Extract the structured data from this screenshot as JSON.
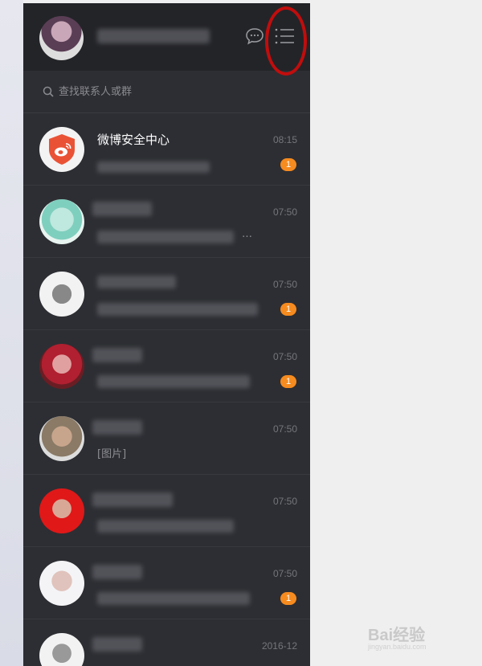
{
  "search": {
    "placeholder": "查找联系人或群"
  },
  "conversations": [
    {
      "name": "微博安全中心",
      "time": "08:15",
      "preview": "",
      "badge": "1"
    },
    {
      "name": "",
      "time": "07:50",
      "preview": "…",
      "badge": ""
    },
    {
      "name": "",
      "time": "07:50",
      "preview": "",
      "badge": "1"
    },
    {
      "name": "",
      "time": "07:50",
      "preview": "",
      "badge": "1"
    },
    {
      "name": "",
      "time": "07:50",
      "preview": "[图片]",
      "badge": ""
    },
    {
      "name": "",
      "time": "07:50",
      "preview": "",
      "badge": ""
    },
    {
      "name": "",
      "time": "07:50",
      "preview": "",
      "badge": "1"
    },
    {
      "name": "",
      "time": "2016-12",
      "preview": "",
      "badge": ""
    }
  ],
  "watermark": {
    "brand": "Bai经验",
    "sub": "jingyan.baidu.com"
  },
  "icons": {
    "chat": "chat-bubble-icon",
    "menu": "list-menu-icon",
    "search": "search-icon",
    "weibo": "weibo-shield-icon"
  },
  "colors": {
    "panel": "#2d2e33",
    "header": "#232428",
    "badge": "#f68b1f",
    "highlight_ring": "#c10d0d"
  }
}
